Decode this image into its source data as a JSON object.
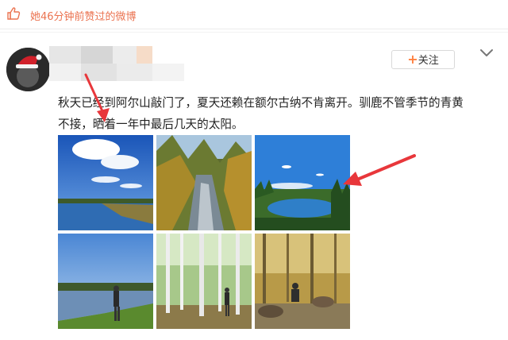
{
  "liked_bar": {
    "icon": "thumbs-up-icon",
    "text": "她46分钟前赞过的微博"
  },
  "author": {
    "avatar": "avatar-santa-hat",
    "name_blurred": true
  },
  "follow_button": {
    "icon": "plus-icon",
    "label": "关注"
  },
  "menu_icon": "chevron-down-icon",
  "post": {
    "line1": "秋天已经到阿尔山敲门了，夏天还赖在额尔古纳不肯离开。驯鹿不管季节的青黄",
    "line2": "不接，晒着一年中最后几天的太阳。"
  },
  "photos": [
    {
      "name": "photo-sky-lake"
    },
    {
      "name": "photo-forest-stream"
    },
    {
      "name": "photo-blue-lake"
    },
    {
      "name": "photo-river-person"
    },
    {
      "name": "photo-birch-forest"
    },
    {
      "name": "photo-reindeer"
    }
  ],
  "colors": {
    "accent": "#eb7350",
    "follow_plus": "#ff8140",
    "annotation_arrow": "#e8373b"
  }
}
